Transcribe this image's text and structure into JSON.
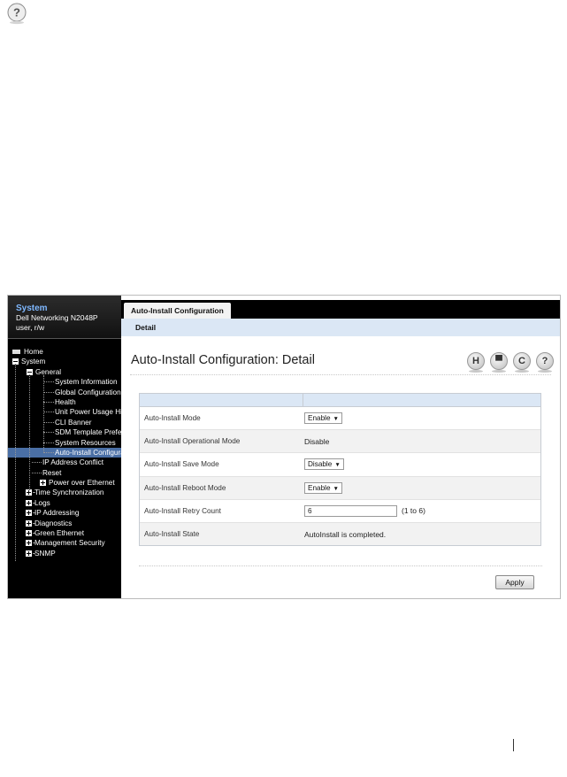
{
  "sidebar": {
    "title": "System",
    "model": "Dell Networking N2048P",
    "user": "user, r/w",
    "tree": [
      {
        "label": "Home",
        "level": 0,
        "toggle": "home"
      },
      {
        "label": "System",
        "level": 0,
        "toggle": "minus"
      },
      {
        "label": "General",
        "level": 1,
        "toggle": "minus"
      },
      {
        "label": "System Information",
        "level": 2,
        "toggle": "none"
      },
      {
        "label": "Global Configuration",
        "level": 2,
        "toggle": "none"
      },
      {
        "label": "Health",
        "level": 2,
        "toggle": "none"
      },
      {
        "label": "Unit Power Usage History",
        "level": 2,
        "toggle": "none"
      },
      {
        "label": "CLI Banner",
        "level": 2,
        "toggle": "none"
      },
      {
        "label": "SDM Template Preference",
        "level": 2,
        "toggle": "none"
      },
      {
        "label": "System Resources",
        "level": 2,
        "toggle": "none"
      },
      {
        "label": "Auto-Install Configuration",
        "level": 2,
        "toggle": "none",
        "selected": true
      },
      {
        "label": "IP Address Conflict",
        "level": 1,
        "toggle": "none"
      },
      {
        "label": "Reset",
        "level": 1,
        "toggle": "none"
      },
      {
        "label": "Power over Ethernet",
        "level": 1,
        "toggle": "plus"
      },
      {
        "label": "Time Synchronization",
        "level": 0,
        "toggle": "plus",
        "child": true
      },
      {
        "label": "Logs",
        "level": 0,
        "toggle": "plus",
        "child": true
      },
      {
        "label": "IP Addressing",
        "level": 0,
        "toggle": "plus",
        "child": true
      },
      {
        "label": "Diagnostics",
        "level": 0,
        "toggle": "plus",
        "child": true
      },
      {
        "label": "Green Ethernet",
        "level": 0,
        "toggle": "plus",
        "child": true
      },
      {
        "label": "Management Security",
        "level": 0,
        "toggle": "plus",
        "child": true
      },
      {
        "label": "SNMP",
        "level": 0,
        "toggle": "plus",
        "child": true
      }
    ]
  },
  "tab": {
    "label": "Auto-Install Configuration"
  },
  "subtab": {
    "label": "Detail"
  },
  "page": {
    "title": "Auto-Install Configuration: Detail"
  },
  "tools": [
    {
      "glyph": "H",
      "icon": "save-icon"
    },
    {
      "glyph": "▀",
      "icon": "print-icon"
    },
    {
      "glyph": "C",
      "icon": "refresh-icon"
    },
    {
      "glyph": "?",
      "icon": "help-icon"
    }
  ],
  "config": {
    "rows": [
      {
        "label": "Auto-Install Mode",
        "type": "select",
        "value": "Enable"
      },
      {
        "label": "Auto-Install Operational Mode",
        "type": "text",
        "value": "Disable"
      },
      {
        "label": "Auto-Install Save Mode",
        "type": "select",
        "value": "Disable"
      },
      {
        "label": "Auto-Install Reboot Mode",
        "type": "select",
        "value": "Enable"
      },
      {
        "label": "Auto-Install Retry Count",
        "type": "input",
        "value": "6",
        "range": "(1 to 6)"
      },
      {
        "label": "Auto-Install State",
        "type": "text",
        "value": "AutoInstall is completed."
      }
    ]
  },
  "apply": {
    "label": "Apply"
  },
  "page_help_glyph": "?"
}
